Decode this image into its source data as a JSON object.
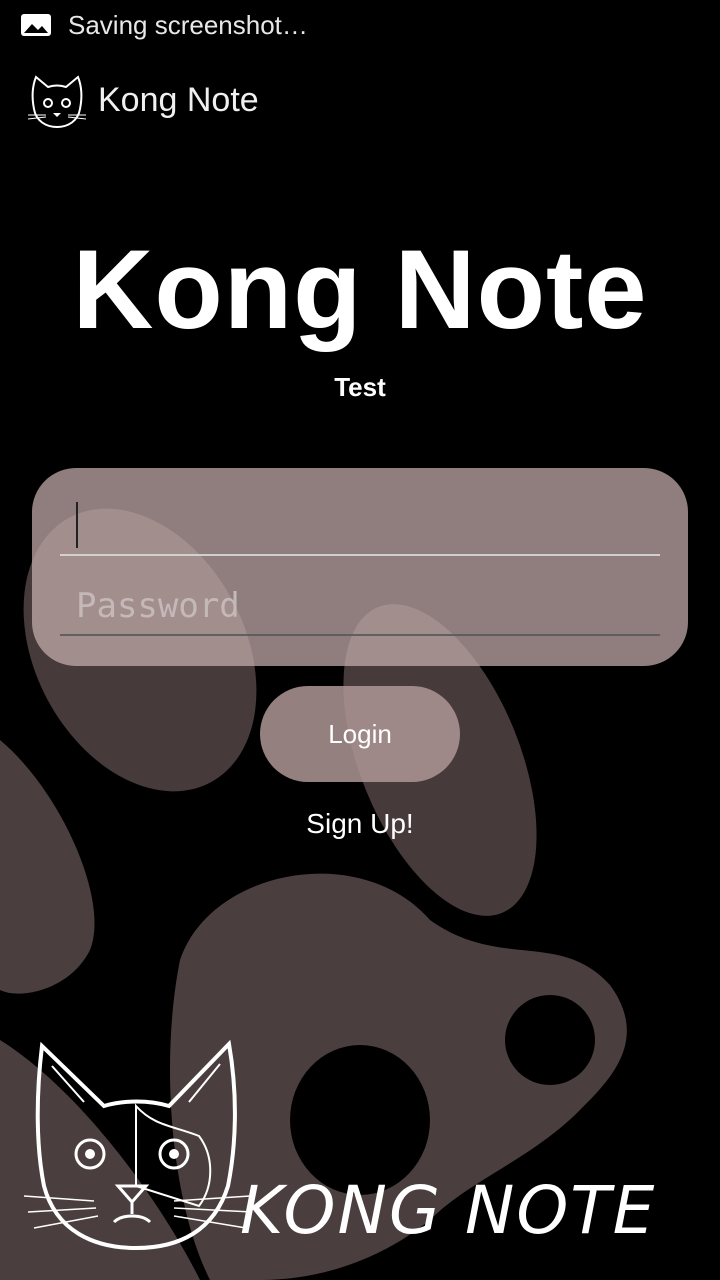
{
  "status_bar": {
    "notification_text": "Saving screenshot…",
    "icon": "image-icon"
  },
  "action_bar": {
    "app_name": "Kong Note",
    "icon": "cat-icon"
  },
  "hero": {
    "title": "Kong Note",
    "subtitle": "Test"
  },
  "form": {
    "username": {
      "value": "",
      "placeholder": ""
    },
    "password": {
      "value": "",
      "placeholder": "Password"
    }
  },
  "buttons": {
    "login_label": "Login",
    "signup_label": "Sign Up!"
  },
  "branding": {
    "wordmark": "KONG NOTE",
    "logo": "cat-face-logo"
  },
  "colors": {
    "background": "#000000",
    "form_card": "#a08888",
    "button": "#b09595",
    "blobs": "#4a3f3e"
  }
}
